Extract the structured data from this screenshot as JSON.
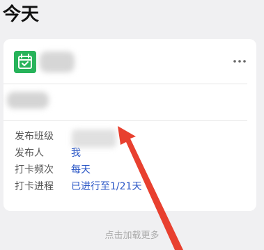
{
  "section_title": "今天",
  "card": {
    "app_icon": "calendar-check-icon",
    "more_icon": "more-horizontal-icon",
    "info_rows": [
      {
        "label": "发布班级",
        "value": ""
      },
      {
        "label": "发布人",
        "value": "我"
      },
      {
        "label": "打卡频次",
        "value": "每天"
      },
      {
        "label": "打卡进程",
        "value": "已进行至1/21天"
      }
    ]
  },
  "load_more": "点击加载更多",
  "colors": {
    "accent_green": "#27b35a",
    "link_blue": "#2a56c6",
    "annotation_red": "#e8402f",
    "page_bg": "#f0f0f2"
  }
}
